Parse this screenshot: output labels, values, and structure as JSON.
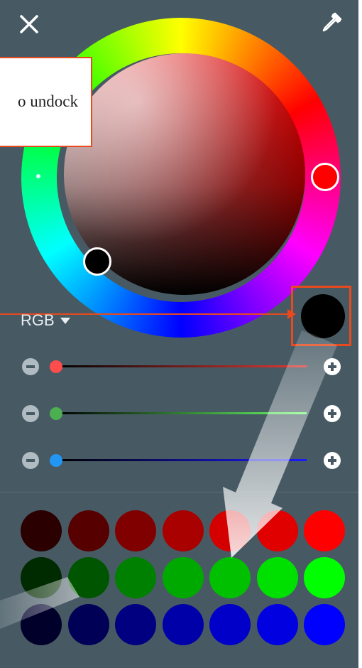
{
  "tooltip": {
    "text": "o undock"
  },
  "mode_selector": {
    "label": "RGB"
  },
  "icons": {
    "close": "close-icon",
    "picker": "eyedropper-icon"
  },
  "current_color": "#000000",
  "hue_color": "#ff0000",
  "sliders": [
    {
      "name": "red",
      "thumb_color": "#ff4d4d",
      "track_colors": [
        "#000000",
        "#e53935"
      ],
      "value": 0
    },
    {
      "name": "green",
      "thumb_color": "#4caf50",
      "track_colors": [
        "#000000",
        "#66ff66"
      ],
      "value": 0
    },
    {
      "name": "blue",
      "thumb_color": "#2196f3",
      "track_colors": [
        "#000000",
        "#1a1aff"
      ],
      "value": 0
    }
  ],
  "swatches": [
    [
      "#2b0000",
      "#560000",
      "#800000",
      "#a90000",
      "#d40000",
      "#e00000",
      "#ff0000"
    ],
    [
      "#002b00",
      "#005600",
      "#008000",
      "#00a900",
      "#00c000",
      "#00e000",
      "#00ff00"
    ],
    [
      "#00002b",
      "#000056",
      "#000080",
      "#0000a9",
      "#0000c8",
      "#0000e0",
      "#0000ff"
    ]
  ],
  "accent_color": "#e8491d"
}
